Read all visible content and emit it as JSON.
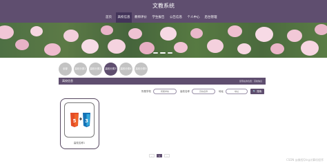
{
  "header": {
    "title": "文教系统",
    "nav": [
      "首页",
      "高校信息",
      "教师评价",
      "学生报告",
      "公告信息",
      "个人中心",
      "后台管理"
    ],
    "active_nav": 1
  },
  "banner": {
    "slide_count": 3,
    "active_slide": 1
  },
  "categories": {
    "items": [
      "全部",
      "高校分类1",
      "高校分类2",
      "高校分类3",
      "高校分类4",
      "高校分类5"
    ],
    "active": 3
  },
  "section": {
    "title": "高校信息",
    "breadcrumb": "您现在的位置：高校信息"
  },
  "filters": {
    "school_label": "所属学校",
    "school_placeholder": "所属学校",
    "name_label": "高校名称",
    "name_placeholder": "高校名称",
    "address_label": "地址",
    "address_placeholder": "地址",
    "search_label": "🔍 搜索"
  },
  "cards": [
    {
      "caption": "高校名称1",
      "image": "html5-to-css3-logo"
    }
  ],
  "pagination": {
    "prev": "‹",
    "pages": [
      "1"
    ],
    "active": "1",
    "next": "›"
  },
  "watermark": "CSDN @美程Qing计算机程序",
  "colors": {
    "primary": "#5f4e6f",
    "active_nav": "#43345a",
    "inactive_category": "#c3c3c3"
  }
}
